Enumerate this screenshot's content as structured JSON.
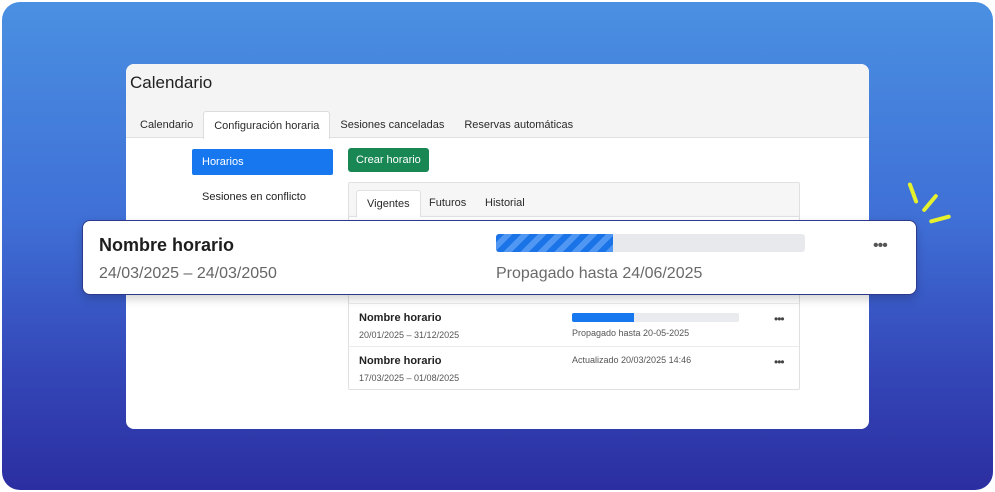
{
  "app": {
    "title": "Calendario"
  },
  "main_tabs": [
    {
      "label": "Calendario",
      "active": false
    },
    {
      "label": "Configuración horaria",
      "active": true
    },
    {
      "label": "Sesiones canceladas",
      "active": false
    },
    {
      "label": "Reservas automáticas",
      "active": false
    }
  ],
  "sidebar": {
    "items": [
      {
        "label": "Horarios",
        "active": true
      },
      {
        "label": "Sesiones en conflicto",
        "active": false
      }
    ]
  },
  "toolbar": {
    "create_label": "Crear horario"
  },
  "sub_tabs": [
    {
      "label": "Vigentes",
      "active": true
    },
    {
      "label": "Futuros",
      "active": false
    },
    {
      "label": "Historial",
      "active": false
    }
  ],
  "rows": [
    {
      "name": "Nombre horario",
      "dates": "20/01/2025 – 31/12/2025",
      "status": "Propagado hasta 20-05-2025",
      "progress": 0.37,
      "menu": "•••"
    },
    {
      "name": "Nombre horario",
      "dates": "17/03/2025 – 01/08/2025",
      "status": "Actualizado 20/03/2025 14:46",
      "menu": "•••"
    }
  ],
  "highlight_card": {
    "name": "Nombre horario",
    "dates": "24/03/2025 – 24/03/2050",
    "status": "Propagado hasta 24/06/2025",
    "progress": 0.38,
    "menu": "•••"
  },
  "colors": {
    "accent": "#1677ef",
    "create_button": "#198754",
    "background_gradient_top": "#4a90e2",
    "background_gradient_bottom": "#2b2ea0",
    "spark": "#e6f12d"
  }
}
